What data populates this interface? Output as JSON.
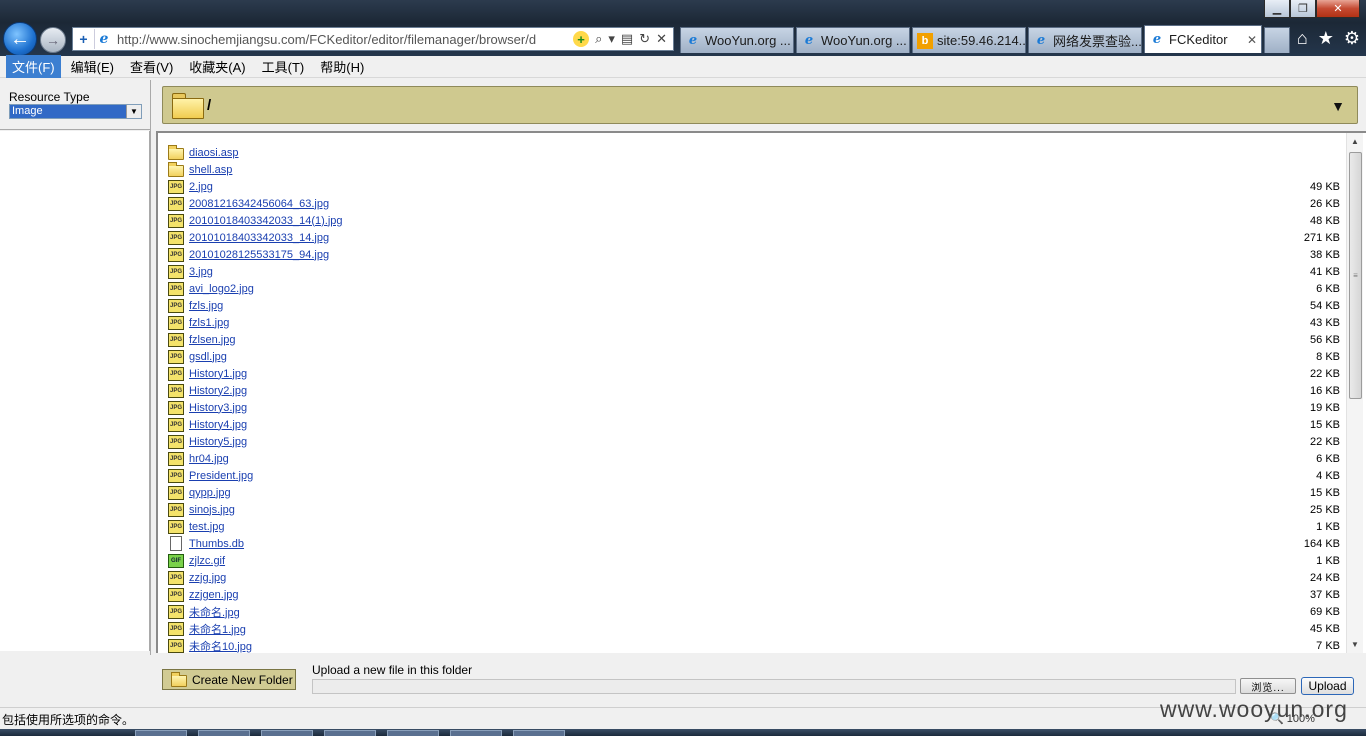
{
  "browser": {
    "address": "http://www.sinochemjiangsu.com/FCKeditor/editor/filemanager/browser/d",
    "address_domain": "www.sinochemjiangsu.com",
    "tabs": [
      {
        "label": "WooYun.org ...",
        "icon": "ie-icon"
      },
      {
        "label": "WooYun.org ...",
        "icon": "ie-icon"
      },
      {
        "label": "site:59.46.214...",
        "icon": "bing-icon"
      },
      {
        "label": "网络发票查验...",
        "icon": "ie-icon"
      },
      {
        "label": "FCKeditor",
        "icon": "ie-icon",
        "active": true
      }
    ]
  },
  "menu": [
    "文件(F)",
    "编辑(E)",
    "查看(V)",
    "收藏夹(A)",
    "工具(T)",
    "帮助(H)"
  ],
  "resource": {
    "label": "Resource Type",
    "selected": "Image"
  },
  "folder": {
    "path": "/"
  },
  "files": [
    {
      "name": "diaosi.asp",
      "type": "folder",
      "size": ""
    },
    {
      "name": "shell.asp",
      "type": "folder",
      "size": ""
    },
    {
      "name": "2.jpg",
      "type": "jpg",
      "size": "49 KB"
    },
    {
      "name": "20081216342456064_63.jpg",
      "type": "jpg",
      "size": "26 KB"
    },
    {
      "name": "20101018403342033_14(1).jpg",
      "type": "jpg",
      "size": "48 KB"
    },
    {
      "name": "20101018403342033_14.jpg",
      "type": "jpg",
      "size": "271 KB"
    },
    {
      "name": "20101028125533175_94.jpg",
      "type": "jpg",
      "size": "38 KB"
    },
    {
      "name": "3.jpg",
      "type": "jpg",
      "size": "41 KB"
    },
    {
      "name": "avi_logo2.jpg",
      "type": "jpg",
      "size": "6 KB"
    },
    {
      "name": "fzls.jpg",
      "type": "jpg",
      "size": "54 KB"
    },
    {
      "name": "fzls1.jpg",
      "type": "jpg",
      "size": "43 KB"
    },
    {
      "name": "fzlsen.jpg",
      "type": "jpg",
      "size": "56 KB"
    },
    {
      "name": "gsdl.jpg",
      "type": "jpg",
      "size": "8 KB"
    },
    {
      "name": "History1.jpg",
      "type": "jpg",
      "size": "22 KB"
    },
    {
      "name": "History2.jpg",
      "type": "jpg",
      "size": "16 KB"
    },
    {
      "name": "History3.jpg",
      "type": "jpg",
      "size": "19 KB"
    },
    {
      "name": "History4.jpg",
      "type": "jpg",
      "size": "15 KB"
    },
    {
      "name": "History5.jpg",
      "type": "jpg",
      "size": "22 KB"
    },
    {
      "name": "hr04.jpg",
      "type": "jpg",
      "size": "6 KB"
    },
    {
      "name": "President.jpg",
      "type": "jpg",
      "size": "4 KB"
    },
    {
      "name": "qypp.jpg",
      "type": "jpg",
      "size": "15 KB"
    },
    {
      "name": "sinojs.jpg",
      "type": "jpg",
      "size": "25 KB"
    },
    {
      "name": "test.jpg",
      "type": "jpg",
      "size": "1 KB"
    },
    {
      "name": "Thumbs.db",
      "type": "db",
      "size": "164 KB"
    },
    {
      "name": "zjlzc.gif",
      "type": "gif",
      "size": "1 KB"
    },
    {
      "name": "zzjg.jpg",
      "type": "jpg",
      "size": "24 KB"
    },
    {
      "name": "zzjgen.jpg",
      "type": "jpg",
      "size": "37 KB"
    },
    {
      "name": "未命名.jpg",
      "type": "jpg",
      "size": "69 KB"
    },
    {
      "name": "未命名1.jpg",
      "type": "jpg",
      "size": "45 KB"
    },
    {
      "name": "未命名10.jpg",
      "type": "jpg",
      "size": "7 KB"
    }
  ],
  "bottom": {
    "create_folder": "Create New Folder",
    "upload_label": "Upload a new file in this folder",
    "browse": "浏览...",
    "upload": "Upload"
  },
  "status": {
    "text": "包括使用所选项的命令。",
    "zoom": "100%",
    "watermark": "www.wooyun.org"
  }
}
